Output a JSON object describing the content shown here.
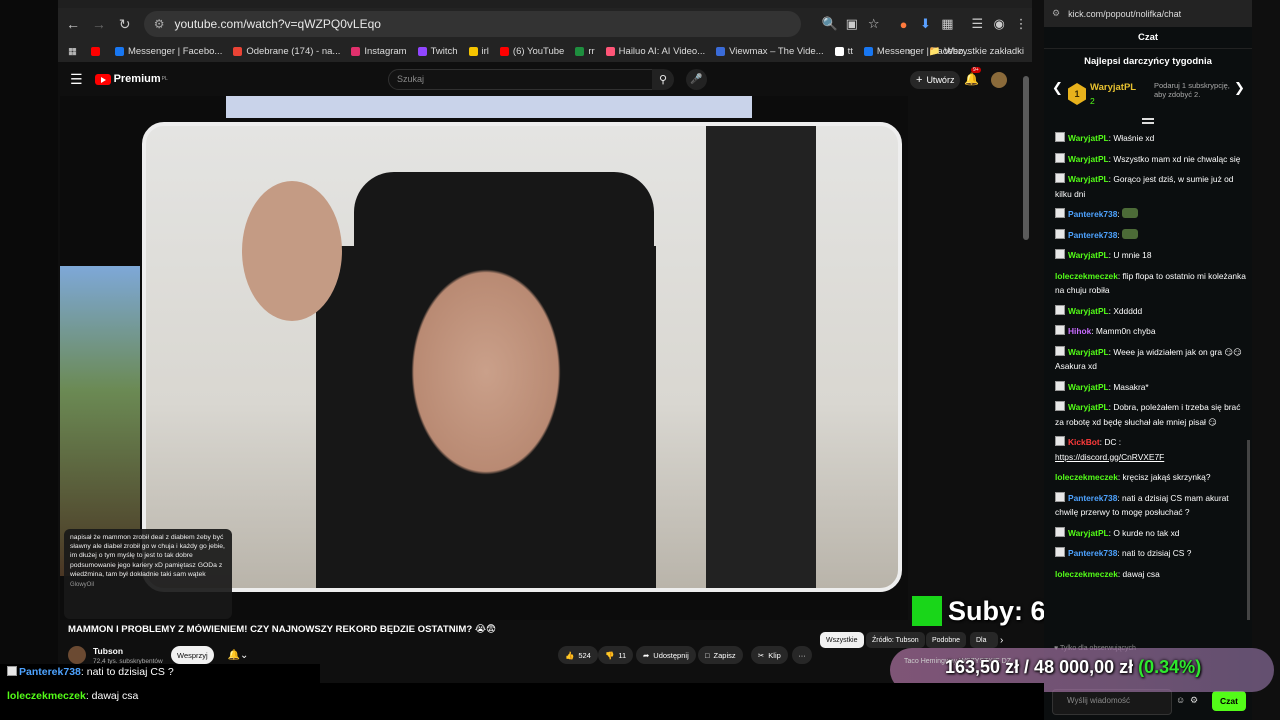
{
  "browser": {
    "url": "youtube.com/watch?v=qWZPQ0vLEqo",
    "bookmarks": [
      {
        "label": "",
        "color": "#ff0000"
      },
      {
        "label": "Messenger | Facebo...",
        "color": "#1877f2"
      },
      {
        "label": "Odebrane (174) - na...",
        "color": "#ea4335"
      },
      {
        "label": "Instagram",
        "color": "#e1306c"
      },
      {
        "label": "Twitch",
        "color": "#9146ff"
      },
      {
        "label": "irl",
        "color": "#f5c400"
      },
      {
        "label": "(6) YouTube",
        "color": "#ff0000"
      },
      {
        "label": "rr",
        "color": "#1e8e3e"
      },
      {
        "label": "Hailuo AI: AI Video...",
        "color": "#ff5577"
      },
      {
        "label": "Viewmax – The Vide...",
        "color": "#3a6bd8"
      },
      {
        "label": "tt",
        "color": "#ffffff"
      },
      {
        "label": "Messenger | Facebo...",
        "color": "#1877f2"
      }
    ],
    "more_bookmarks": "»",
    "all_bookmarks": "Wszystkie zakładki"
  },
  "youtube": {
    "logo_text": "Premium",
    "logo_region": "PL",
    "search_placeholder": "Szukaj",
    "create_label": "Utwórz",
    "notif_count": "9+",
    "video_title": "MAMMON I PROBLEMY Z MÓWIENIEM! CZY NAJNOWSZY REKORD BĘDZIE OSTATNIM? 😭😨",
    "channel_name": "Tubson",
    "channel_subs": "72,4 tys. subskrybentów",
    "support_label": "Wesprzyj",
    "likes": "524",
    "dislikes": "11",
    "share_label": "Udostępnij",
    "save_label": "Zapisz",
    "clip_label": "Klip",
    "more_label": "···",
    "chips": [
      "Wszystkie",
      "Źródło: Tubson",
      "Podobne",
      "Dla"
    ],
    "overlay_message": "napisał że mammon zrobił deal z diabłem żeby być sławny ale diabeł zrobił go w chuja i każdy go jebie, im dłużej o tym myślę to jest to tak dobre podsumowanie jego kariery xD pamiętasz GODa z wiedźmina, tam był dokładnie taki sam wątek",
    "overlay_user": "GlowyOil"
  },
  "overlay": {
    "suby_label": "Suby: 6",
    "goal_text": "163,50 zł / 48 000,00 zł",
    "goal_pct": "(0.34%)",
    "goal_sub": "Taco Hemingway WSZYSTKIE DZ...",
    "goal_fraction": 0.0034
  },
  "chat": {
    "url": "kick.com/popout/nolifka/chat",
    "title": "Czat",
    "donors_title": "Najlepsi darczyńcy tygodnia",
    "top_donor": {
      "rank": "1",
      "name": "WaryjatPL",
      "count": "2"
    },
    "donor_hint": "Podaruj 1 subskrypcję, aby zdobyć 2.",
    "messages": [
      {
        "user": "WaryjatPL",
        "color": "#53fc18",
        "badge": true,
        "text": "Właśnie xd"
      },
      {
        "user": "WaryjatPL",
        "color": "#53fc18",
        "badge": true,
        "text": "Wszystko mam xd nie chwaląc się"
      },
      {
        "user": "WaryjatPL",
        "color": "#53fc18",
        "badge": true,
        "text": "Gorąco jest dziś, w sumie już od kilku dni"
      },
      {
        "user": "Panterek738",
        "color": "#4ea3ff",
        "badge": true,
        "text": "",
        "emote": true
      },
      {
        "user": "Panterek738",
        "color": "#4ea3ff",
        "badge": true,
        "text": "",
        "emote": true
      },
      {
        "user": "WaryjatPL",
        "color": "#53fc18",
        "badge": true,
        "text": "U mnie 18"
      },
      {
        "user": "loleczekmeczek",
        "color": "#53fc18",
        "badge": false,
        "text": "flip flopa to ostatnio mi koleżanka na chuju robiła"
      },
      {
        "user": "WaryjatPL",
        "color": "#53fc18",
        "badge": true,
        "text": "Xddddd"
      },
      {
        "user": "Hihok",
        "color": "#c86bff",
        "badge": true,
        "text": "Mamm0n chyba"
      },
      {
        "user": "WaryjatPL",
        "color": "#53fc18",
        "badge": true,
        "text": "Weee ja widziałem jak on gra 😏😏 Asakura xd"
      },
      {
        "user": "WaryjatPL",
        "color": "#53fc18",
        "badge": true,
        "text": "Masakra*"
      },
      {
        "user": "WaryjatPL",
        "color": "#53fc18",
        "badge": true,
        "text": "Dobra, poleżałem i trzeba się brać za robotę xd będę słuchał ale mniej pisał 😏"
      },
      {
        "user": "KickBot",
        "color": "#ff3b3b",
        "badge": true,
        "text": "DC :",
        "link": "https://discord.gg/CnRVXE7F"
      },
      {
        "user": "loleczekmeczek",
        "color": "#53fc18",
        "badge": false,
        "text": "kręcisz jakąś skrzynką?"
      },
      {
        "user": "Panterek738",
        "color": "#4ea3ff",
        "badge": true,
        "text": "nati a dzisiaj CS mam akurat chwilę przerwy to mogę posłuchać ?"
      },
      {
        "user": "WaryjatPL",
        "color": "#53fc18",
        "badge": true,
        "text": "O kurde no tak xd"
      },
      {
        "user": "Panterek738",
        "color": "#4ea3ff",
        "badge": true,
        "text": "nati to dzisiaj CS ?"
      },
      {
        "user": "loleczekmeczek",
        "color": "#53fc18",
        "badge": false,
        "text": "dawaj csa"
      }
    ],
    "sub_only": "Tylko dla obserwujących",
    "input_placeholder": "Wyślij wiadomość",
    "send_label": "Czat"
  },
  "ticker": [
    {
      "user": "Panterek738",
      "color": "#4ea3ff",
      "badge": true,
      "text": "nati to dzisiaj CS ?"
    },
    {
      "user": "loleczekmeczek",
      "color": "#53fc18",
      "badge": false,
      "text": "dawaj csa"
    }
  ]
}
